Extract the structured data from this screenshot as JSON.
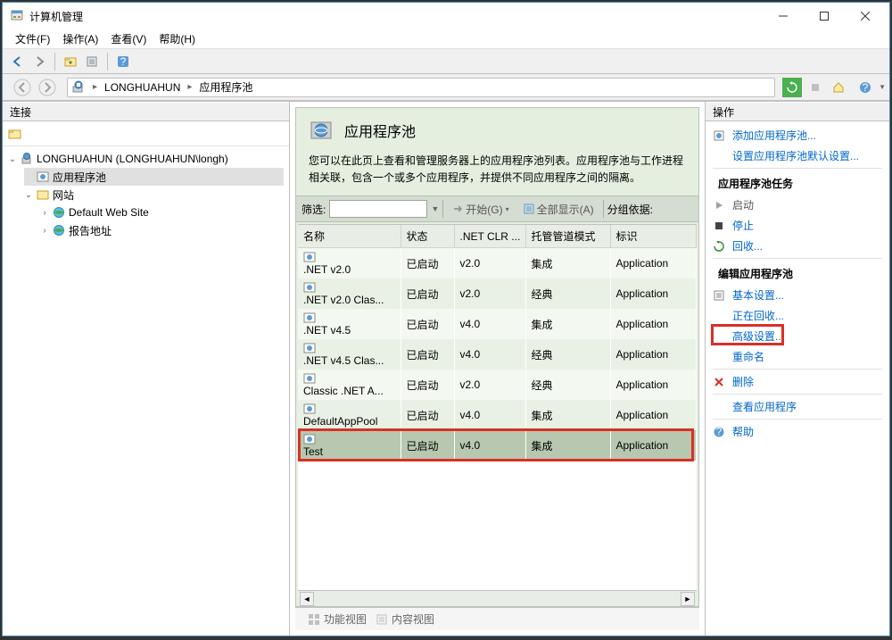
{
  "window": {
    "title": "计算机管理"
  },
  "menu": {
    "file": "文件(F)",
    "action": "操作(A)",
    "view": "查看(V)",
    "help": "帮助(H)"
  },
  "breadcrumb": {
    "item1": "LONGHUAHUN",
    "item2": "应用程序池"
  },
  "left": {
    "header": "连接",
    "server": "LONGHUAHUN (LONGHUAHUN\\longh)",
    "app_pools": "应用程序池",
    "sites": "网站",
    "site1": "Default Web Site",
    "site2": "报告地址"
  },
  "center": {
    "title": "应用程序池",
    "desc": "您可以在此页上查看和管理服务器上的应用程序池列表。应用程序池与工作进程相关联，包含一个或多个应用程序，并提供不同应用程序之间的隔离。",
    "filter_label": "筛选:",
    "filter_value": "",
    "go_label": "开始(G)",
    "show_all_label": "全部显示(A)",
    "group_label": "分组依据:",
    "columns": {
      "name": "名称",
      "status": "状态",
      "clr": ".NET CLR ...",
      "pipeline": "托管管道模式",
      "identity": "标识"
    },
    "rows": [
      {
        "name": ".NET v2.0",
        "status": "已启动",
        "clr": "v2.0",
        "pipeline": "集成",
        "identity": "Application"
      },
      {
        "name": ".NET v2.0 Clas...",
        "status": "已启动",
        "clr": "v2.0",
        "pipeline": "经典",
        "identity": "Application"
      },
      {
        "name": ".NET v4.5",
        "status": "已启动",
        "clr": "v4.0",
        "pipeline": "集成",
        "identity": "Application"
      },
      {
        "name": ".NET v4.5 Clas...",
        "status": "已启动",
        "clr": "v4.0",
        "pipeline": "经典",
        "identity": "Application"
      },
      {
        "name": "Classic .NET A...",
        "status": "已启动",
        "clr": "v2.0",
        "pipeline": "经典",
        "identity": "Application"
      },
      {
        "name": "DefaultAppPool",
        "status": "已启动",
        "clr": "v4.0",
        "pipeline": "集成",
        "identity": "Application"
      },
      {
        "name": "Test",
        "status": "已启动",
        "clr": "v4.0",
        "pipeline": "集成",
        "identity": "Application"
      }
    ],
    "tabs": {
      "features": "功能视图",
      "content": "内容视图"
    }
  },
  "right": {
    "header": "操作",
    "add_pool": "添加应用程序池...",
    "set_defaults": "设置应用程序池默认设置...",
    "tasks_section": "应用程序池任务",
    "start": "启动",
    "stop": "停止",
    "recycle": "回收...",
    "edit_section": "编辑应用程序池",
    "basic_settings": "基本设置...",
    "recycling": "正在回收...",
    "advanced_settings": "高级设置...",
    "rename": "重命名",
    "delete": "删除",
    "view_apps": "查看应用程序",
    "help": "帮助"
  }
}
